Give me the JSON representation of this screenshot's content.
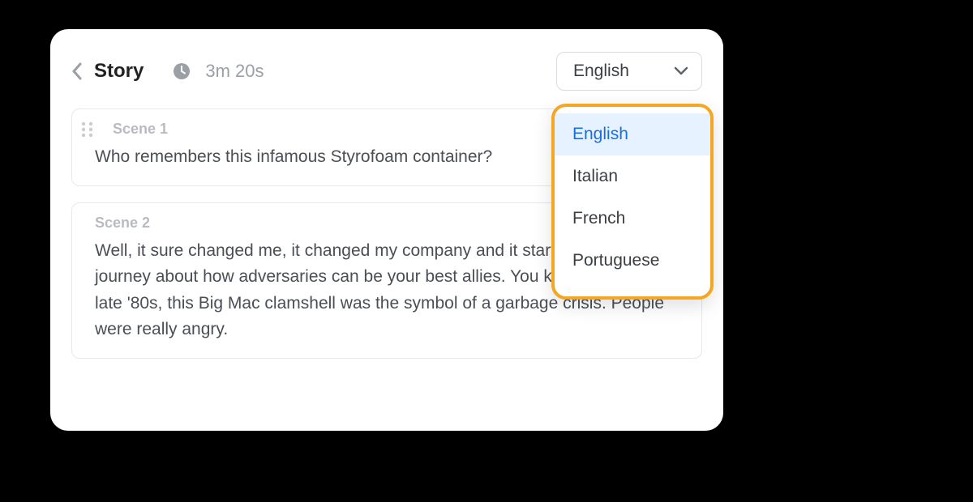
{
  "header": {
    "title": "Story",
    "duration": "3m 20s"
  },
  "language_select": {
    "current": "English",
    "options": [
      "English",
      "Italian",
      "French",
      "Portuguese"
    ]
  },
  "scenes": [
    {
      "label": "Scene 1",
      "text": "Who remembers this infamous Styrofoam container?"
    },
    {
      "label": "Scene 2",
      "text": "Well, it sure changed me, it changed my company and it started a revelatory journey about how adversaries can be your best allies.   You know, back in the late '80s, this Big Mac clamshell was the symbol of a garbage crisis. People were really angry."
    }
  ]
}
